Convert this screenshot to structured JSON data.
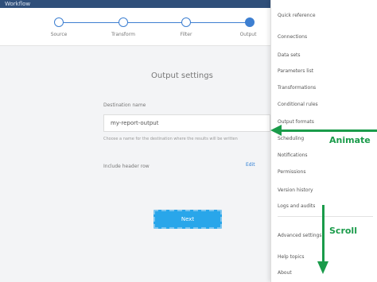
{
  "app": {
    "title": "Workflow"
  },
  "stepper": {
    "steps": [
      {
        "label": "Source"
      },
      {
        "label": "Transform"
      },
      {
        "label": "Filter"
      },
      {
        "label": "Output"
      }
    ]
  },
  "form": {
    "title": "Output settings",
    "field_label": "Destination name",
    "field_value": "my-report-output",
    "help_text": "Choose a name for the destination where the results will be written",
    "option_label": "Include header row",
    "option_toggle": "Edit",
    "next_button": "Next"
  },
  "panel": {
    "items": [
      "Quick reference",
      "Connections",
      "Data sets",
      "Parameters list",
      "Transformations",
      "Conditional rules",
      "Output formats",
      "Scheduling",
      "Notifications",
      "Permissions",
      "Version history",
      "Logs and audits",
      "Advanced settings",
      "Help topics",
      "About"
    ]
  },
  "annotations": {
    "animate": "Animate",
    "scroll": "Scroll",
    "arrow_color": "#1a9b4a"
  }
}
